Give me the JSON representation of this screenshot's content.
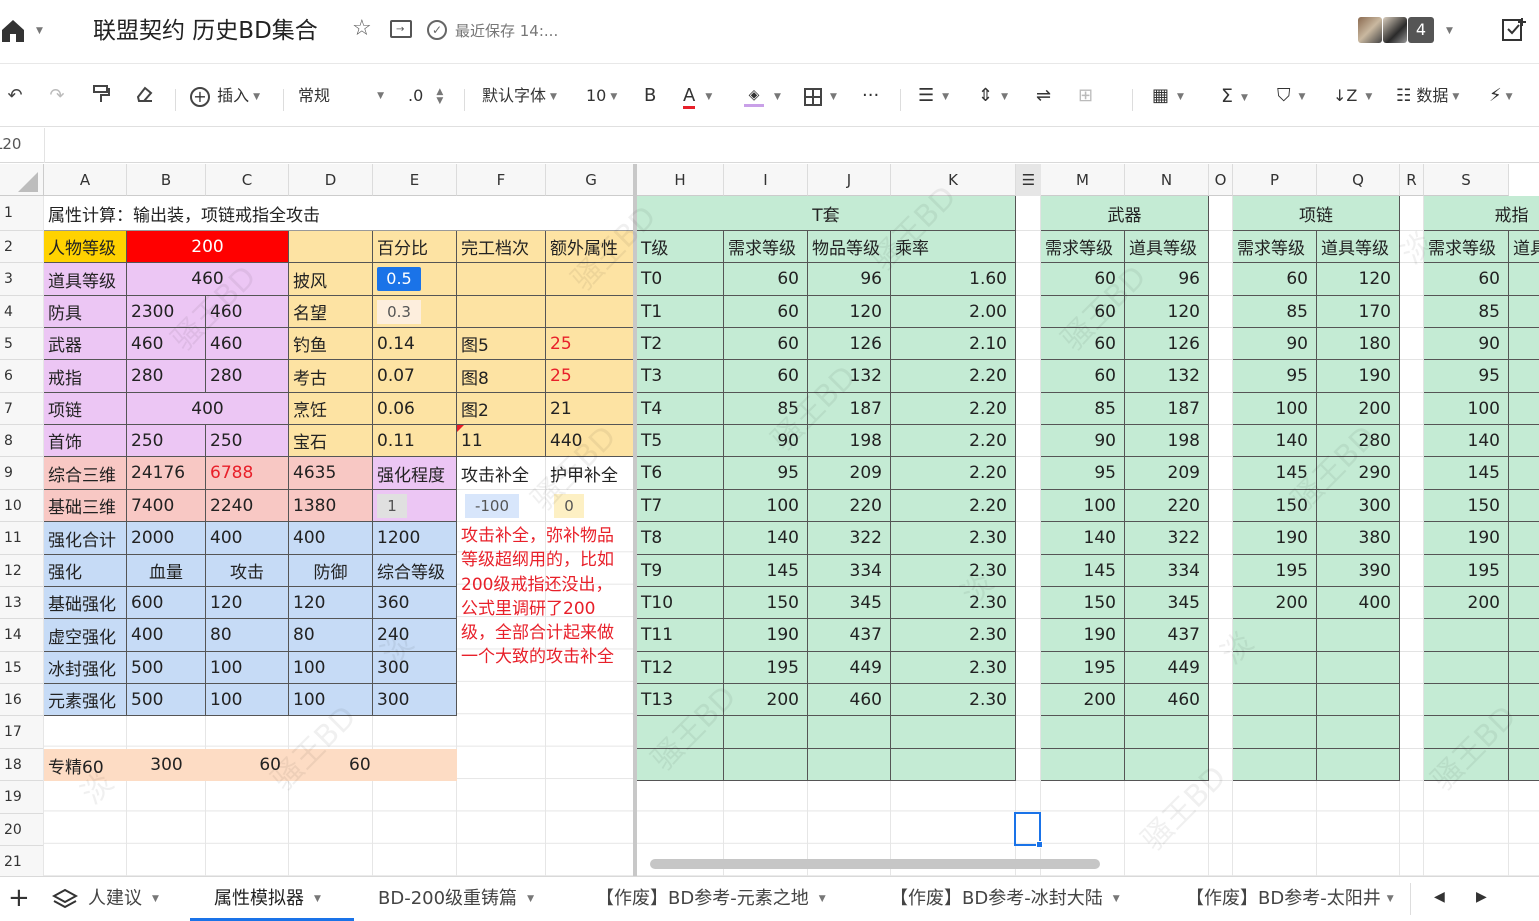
{
  "titlebar": {
    "doc_title": "联盟契约 历史BD集合",
    "save_status": "最近保存 14:...",
    "avatar_count": "4"
  },
  "toolbar": {
    "insert": "插入",
    "format": "常规",
    "decimal": ".0",
    "font": "默认字体",
    "size": "10",
    "bold": "B",
    "font_color": "A",
    "data": "数据"
  },
  "formula_bar": {
    "cell_ref": "L20"
  },
  "columns": [
    "A",
    "B",
    "C",
    "D",
    "E",
    "F",
    "G",
    "H",
    "I",
    "J",
    "K",
    "L",
    "M",
    "N",
    "O",
    "P",
    "Q",
    "R",
    "S"
  ],
  "rows": [
    "1",
    "2",
    "3",
    "4",
    "5",
    "6",
    "7",
    "8",
    "9",
    "10",
    "11",
    "12",
    "13",
    "14",
    "15",
    "16",
    "17",
    "18",
    "19",
    "20",
    "21"
  ],
  "sheet": {
    "r1": {
      "a": "属性计算：输出装，项链戒指全攻击",
      "t_set": "T套",
      "weapon": "武器",
      "necklace": "项链",
      "ring": "戒指"
    },
    "r2": {
      "a": "人物等级",
      "b": "200",
      "e": "百分比",
      "f": "完工档次",
      "g": "额外属性",
      "h": "T级",
      "i": "需求等级",
      "j": "物品等级",
      "k": "乘率",
      "m": "需求等级",
      "n": "道具等级",
      "p": "需求等级",
      "q": "道具等级",
      "s": "需求等级",
      "t": "道具"
    },
    "r3": {
      "a": "道具等级",
      "b": "460",
      "d": "披风",
      "e": "0.5"
    },
    "r4": {
      "a": "防具",
      "b": "2300",
      "c": "460",
      "d": "名望",
      "e": "0.3"
    },
    "r5": {
      "a": "武器",
      "b": "460",
      "c": "460",
      "d": "钓鱼",
      "e": "0.14",
      "f": "图5",
      "g": "25"
    },
    "r6": {
      "a": "戒指",
      "b": "280",
      "c": "280",
      "d": "考古",
      "e": "0.07",
      "f": "图8",
      "g": "25"
    },
    "r7": {
      "a": "项链",
      "b": "400",
      "d": "烹饪",
      "e": "0.06",
      "f": "图2",
      "g": "21"
    },
    "r8": {
      "a": "首饰",
      "b": "250",
      "c": "250",
      "d": "宝石",
      "e": "0.11",
      "f": "11",
      "g": "440"
    },
    "r9": {
      "a": "综合三维",
      "b": "24176",
      "c": "6788",
      "d": "4635",
      "e": "强化程度",
      "f": "攻击补全",
      "g": "护甲补全"
    },
    "r10": {
      "a": "基础三维",
      "b": "7400",
      "c": "2240",
      "d": "1380",
      "e": "1",
      "f": "-100",
      "g": "0"
    },
    "r11": {
      "a": "强化合计",
      "b": "2000",
      "c": "400",
      "d": "400",
      "e": "1200"
    },
    "r12": {
      "a": "强化",
      "b": "血量",
      "c": "攻击",
      "d": "防御",
      "e": "综合等级"
    },
    "r13": {
      "a": "基础强化",
      "b": "600",
      "c": "120",
      "d": "120",
      "e": "360"
    },
    "r14": {
      "a": "虚空强化",
      "b": "400",
      "c": "80",
      "d": "80",
      "e": "240"
    },
    "r15": {
      "a": "冰封强化",
      "b": "500",
      "c": "100",
      "d": "100",
      "e": "300"
    },
    "r16": {
      "a": "元素强化",
      "b": "500",
      "c": "100",
      "d": "100",
      "e": "300"
    },
    "r18": {
      "a": "专精60",
      "b": "300",
      "c": "60",
      "d": "60"
    },
    "note_lines": [
      "攻击补全，弥补物品",
      "等级超纲用的，比如",
      "200级戒指还没出，",
      "公式里调研了200",
      "级，全部合计起来做",
      "一个大致的攻击补全"
    ],
    "tier_rows": [
      {
        "t": "T0",
        "req": "60",
        "item": "96",
        "rate": "1.60",
        "wm": "60",
        "wn": "96",
        "np": "60",
        "nq": "120",
        "rs": "60"
      },
      {
        "t": "T1",
        "req": "60",
        "item": "120",
        "rate": "2.00",
        "wm": "60",
        "wn": "120",
        "np": "85",
        "nq": "170",
        "rs": "85"
      },
      {
        "t": "T2",
        "req": "60",
        "item": "126",
        "rate": "2.10",
        "wm": "60",
        "wn": "126",
        "np": "90",
        "nq": "180",
        "rs": "90"
      },
      {
        "t": "T3",
        "req": "60",
        "item": "132",
        "rate": "2.20",
        "wm": "60",
        "wn": "132",
        "np": "95",
        "nq": "190",
        "rs": "95"
      },
      {
        "t": "T4",
        "req": "85",
        "item": "187",
        "rate": "2.20",
        "wm": "85",
        "wn": "187",
        "np": "100",
        "nq": "200",
        "rs": "100"
      },
      {
        "t": "T5",
        "req": "90",
        "item": "198",
        "rate": "2.20",
        "wm": "90",
        "wn": "198",
        "np": "140",
        "nq": "280",
        "rs": "140"
      },
      {
        "t": "T6",
        "req": "95",
        "item": "209",
        "rate": "2.20",
        "wm": "95",
        "wn": "209",
        "np": "145",
        "nq": "290",
        "rs": "145"
      },
      {
        "t": "T7",
        "req": "100",
        "item": "220",
        "rate": "2.20",
        "wm": "100",
        "wn": "220",
        "np": "150",
        "nq": "300",
        "rs": "150"
      },
      {
        "t": "T8",
        "req": "140",
        "item": "322",
        "rate": "2.30",
        "wm": "140",
        "wn": "322",
        "np": "190",
        "nq": "380",
        "rs": "190"
      },
      {
        "t": "T9",
        "req": "145",
        "item": "334",
        "rate": "2.30",
        "wm": "145",
        "wn": "334",
        "np": "195",
        "nq": "390",
        "rs": "195"
      },
      {
        "t": "T10",
        "req": "150",
        "item": "345",
        "rate": "2.30",
        "wm": "150",
        "wn": "345",
        "np": "200",
        "nq": "400",
        "rs": "200"
      },
      {
        "t": "T11",
        "req": "190",
        "item": "437",
        "rate": "2.30",
        "wm": "190",
        "wn": "437",
        "np": "",
        "nq": "",
        "rs": ""
      },
      {
        "t": "T12",
        "req": "195",
        "item": "449",
        "rate": "2.30",
        "wm": "195",
        "wn": "449",
        "np": "",
        "nq": "",
        "rs": ""
      },
      {
        "t": "T13",
        "req": "200",
        "item": "460",
        "rate": "2.30",
        "wm": "200",
        "wn": "460",
        "np": "",
        "nq": "",
        "rs": ""
      }
    ]
  },
  "watermark": {
    "text1": "骚王BD",
    "text2": "淡"
  },
  "sheet_tabs": [
    "人建议",
    "属性模拟器",
    "BD-200级重铸篇",
    "【作废】BD参考-元素之地",
    "【作废】BD参考-冰封大陆",
    "【作废】BD参考-太阳井"
  ],
  "active_tab": "属性模拟器",
  "colors": {
    "purple": "#ecc6f4",
    "yellow": "#fde3a3",
    "red": "#ff0000",
    "pink": "#f8c8c4",
    "blue": "#c6dbf6",
    "green": "#c4ebd4",
    "orange": "#fddcc4",
    "accent": "#1a73e8"
  }
}
